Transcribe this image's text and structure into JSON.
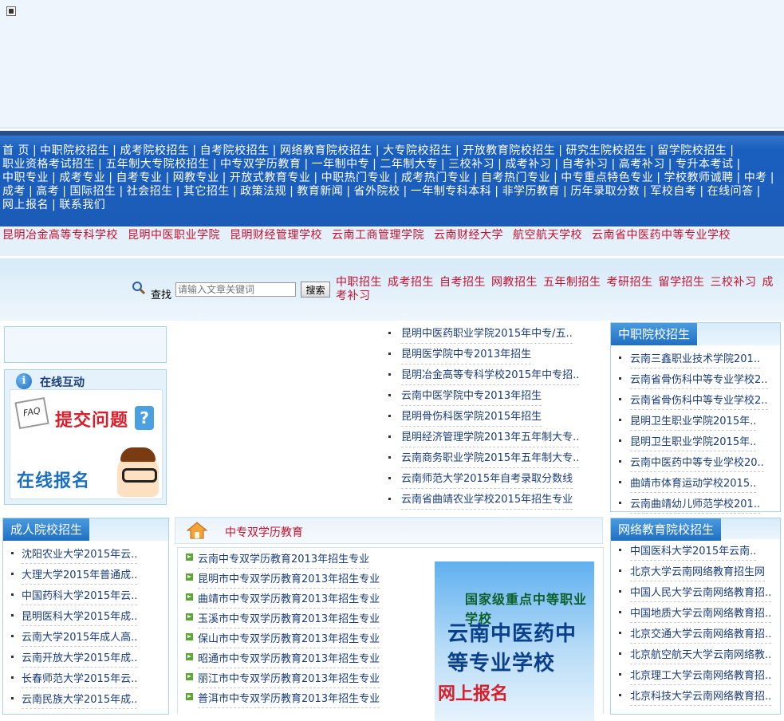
{
  "nav": {
    "items": [
      "首 页",
      "中职院校招生",
      "成考院校招生",
      "自考院校招生",
      "网络教育院校招生",
      "大专院校招生",
      "开放教育院校招生",
      "研究生院校招生",
      "留学院校招生",
      "职业资格考试招生",
      "五年制大专院校招生",
      "中专双学历教育",
      "一年制中专",
      "二年制大专",
      "三校补习",
      "成考补习",
      "自考补习",
      "高考补习",
      "专升本考试",
      "中职专业",
      "成考专业",
      "自考专业",
      "网教专业",
      "开放式教育专业",
      "中职热门专业",
      "成考热门专业",
      "自考热门专业",
      "中专重点特色专业",
      "学校教师诚聘",
      "中考",
      "成考",
      "高考",
      "国际招生",
      "社会招生",
      "其它招生",
      "政策法规",
      "教育新闻",
      "省外院校",
      "一年制专科本科",
      "非学历教育",
      "历年录取分数",
      "军校自考",
      "在线问答",
      "网上报名",
      "联系我们"
    ]
  },
  "schools": [
    "昆明冶金高等专科学校",
    "昆明中医职业学院",
    "昆明财经管理学校",
    "云南工商管理学院",
    "云南财经大学",
    "航空航天学校",
    "云南省中医药中等专业学校"
  ],
  "search": {
    "label": "查找",
    "placeholder": "请输入文章关键词",
    "button": "搜索",
    "quick": [
      "中职招生",
      "成考招生",
      "自考招生",
      "网教招生",
      "五年制招生",
      "考研招生",
      "留学招生",
      "三校补习",
      "成考补习"
    ]
  },
  "interact": {
    "title": "在线互动",
    "ask": "提交问题",
    "register": "在线报名"
  },
  "news": [
    "昆明中医药职业学院2015年中专/五..",
    "昆明医学院中专2013年招生",
    "昆明冶金高等专科学校2015年中专招..",
    "云南中医学院中专2013年招生",
    "昆明骨伤科医学院2015年招生",
    "昆明经济管理学院2013年五年制大专..",
    "云南商务职业学院2015年五年制大专..",
    "云南师范大学2015年自考录取分数线",
    "云南省曲靖农业学校2015年招生专业"
  ],
  "zzy": {
    "title": "中职院校招生",
    "items": [
      "云南三鑫职业技术学院201..",
      "云南省骨伤科中等专业学校2..",
      "云南省骨伤科中等专业学校2..",
      "昆明卫生职业学院2015年..",
      "昆明卫生职业学院2015年..",
      "云南中医药中等专业学校20..",
      "曲靖市体育运动学校2015..",
      "云南曲靖幼儿师范学校201.."
    ]
  },
  "adult": {
    "title": "成人院校招生",
    "items": [
      "沈阳农业大学2015年云..",
      "大理大学2015年普通成..",
      "中国药科大学2015年云..",
      "昆明医科大学2015年成..",
      "云南大学2015年成人高..",
      "云南开放大学2015年成..",
      "长春师范大学2015年云..",
      "云南民族大学2015年成.."
    ]
  },
  "mid": {
    "title": "中专双学历教育",
    "items": [
      "云南中专双学历教育2013年招生专业",
      "昆明市中专双学历教育2013年招生专业",
      "曲靖市中专双学历教育2013年招生专业",
      "玉溪市中专双学历教育2013年招生专业",
      "保山市中专双学历教育2013年招生专业",
      "昭通市中专双学历教育2013年招生专业",
      "丽江市中专双学历教育2013年招生专业",
      "普洱市中专双学历教育2013年招生专业"
    ],
    "ad_line1": "国家级重点中等职业学校",
    "ad_line2": "云南中医药中等专业学校",
    "ad_line3": "网上报名"
  },
  "net": {
    "title": "网络教育院校招生",
    "items": [
      "中国医科大学2015年云南..",
      "北京大学云南网络教育招生网",
      "中国人民大学云南网络教育招..",
      "中国地质大学云南网络教育招..",
      "北京交通大学云南网络教育招..",
      "北京航空航天大学云南网络教..",
      "北京理工大学云南网络教育招..",
      "北京科技大学云南网络教育招.."
    ]
  }
}
